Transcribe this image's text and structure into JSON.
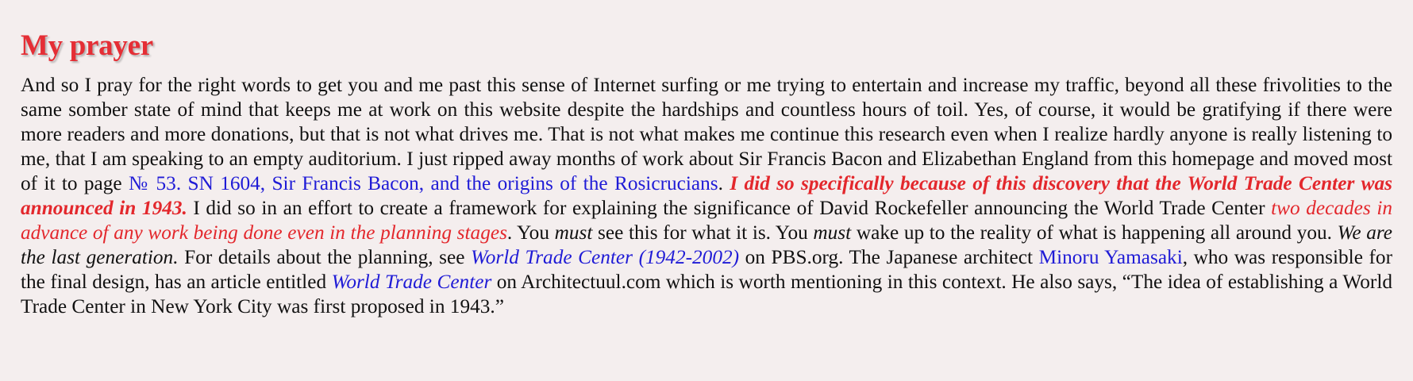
{
  "heading": "My prayer",
  "paragraph": {
    "t1": "And so I pray for the right words to get you and me past this sense of Internet surfing or me trying to entertain and increase my traffic, beyond all these frivolities to the same somber state of mind that keeps me at work on this website despite the hardships and countless hours of toil. Yes, of course, it would be gratifying if there were more readers and more donations, but that is not what drives me. That is not what makes me continue this research even when I realize hardly anyone is really listening to me, that I am speaking to an empty auditorium. I just ripped away months of work about Sir Francis Bacon and Elizabethan England from this homepage and moved most of it to page ",
    "link1": "№ 53. SN 1604, Sir Francis Bacon, and the origins of the Rosicrucians",
    "t2": ". ",
    "red1": "I did so specifically because of this discovery that the World Trade Center was announced in 1943.",
    "t3": " I did so in an effort to create a framework for explaining the significance of David Rockefeller announcing the World Trade Center ",
    "red2": "two decades in advance of any work being done even in the planning stages",
    "t4": ". You ",
    "em1": "must",
    "t5": " see this for what it is. You ",
    "em2": "must",
    "t6": " wake up to the reality of what is happening all around you. ",
    "em3": "We are the last generation.",
    "t7": " For details about the planning, see ",
    "link2": "World Trade Center (1942-2002)",
    "t8": " on PBS.org. The Japanese architect ",
    "link3": "Minoru Yamasaki",
    "t9": ", who was responsible for the final design, has an article entitled ",
    "link4": "World Trade Center",
    "t10": " on Architectuul.com which is worth mentioning in this context. He also says, “The idea of establishing a World Trade Center in New York City was first proposed in 1943.”"
  },
  "colors": {
    "background": "#f4eeee",
    "heading": "#e52e35",
    "link": "#1f1bd6",
    "emphasis_red": "#e3272c",
    "text": "#111111"
  }
}
